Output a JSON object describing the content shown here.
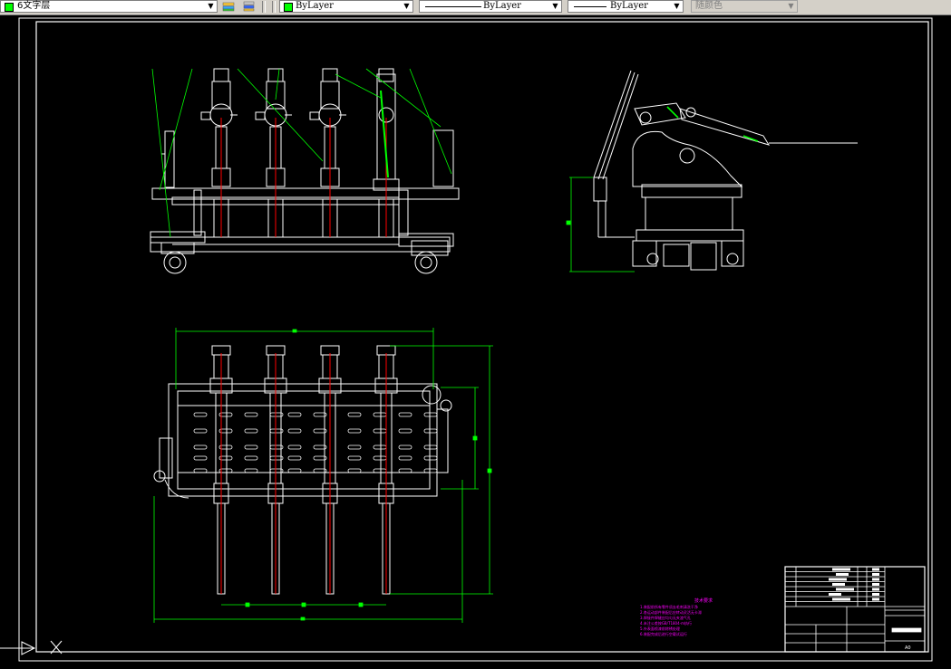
{
  "toolbar": {
    "layer_name": "6文字层",
    "color_value": "ByLayer",
    "linetype_value": "ByLayer",
    "lineweight_value": "ByLayer",
    "plotstyle_value": "随颜色",
    "icons": [
      "layer-state-icon",
      "layer-previous-icon"
    ]
  },
  "drawing": {
    "notes_title": "技术要求",
    "notes_lines": [
      "1.装配前所有零件须去毛刺清洗干净",
      "2.各运动部件装配后应转动灵活无卡滞",
      "3.焊接件焊缝应均匀无夹渣气孔",
      "4.未注公差按GB/T1804-m执行",
      "5.外表面喷漆前除锈处理",
      "6.装配完成后进行空载试运行"
    ],
    "sheet_size": "A0"
  },
  "colors": {
    "background": "#000000",
    "geometry": "#ffffff",
    "dimension": "#00ff00",
    "centerline": "#ff0000",
    "notes": "#ff00ff",
    "ui": "#d4d0c8"
  }
}
